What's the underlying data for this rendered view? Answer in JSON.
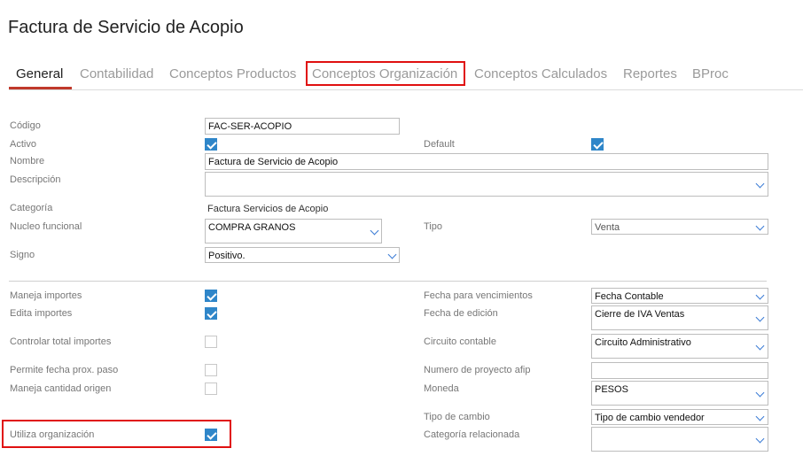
{
  "title": "Factura de Servicio de Acopio",
  "tabs": [
    "General",
    "Contabilidad",
    "Conceptos Productos",
    "Conceptos Organización",
    "Conceptos Calculados",
    "Reportes",
    "BProc"
  ],
  "accent_color": "#c0392b",
  "highlight_color": "#e01010",
  "checkbox_color": "#2f86c9",
  "form": {
    "codigo_label": "Código",
    "codigo_value": "FAC-SER-ACOPIO",
    "activo_label": "Activo",
    "activo_checked": true,
    "default_label": "Default",
    "default_checked": true,
    "nombre_label": "Nombre",
    "nombre_value": "Factura de Servicio de Acopio",
    "descripcion_label": "Descripción",
    "descripcion_value": "",
    "categoria_label": "Categoría",
    "categoria_value": "Factura Servicios de Acopio",
    "nucleo_label": "Nucleo funcional",
    "nucleo_value": "COMPRA GRANOS",
    "tipo_label": "Tipo",
    "tipo_value": "Venta",
    "signo_label": "Signo",
    "signo_value": "Positivo.",
    "maneja_importes_label": "Maneja importes",
    "maneja_importes_checked": true,
    "edita_importes_label": "Edita importes",
    "edita_importes_checked": true,
    "controlar_total_label": "Controlar total importes",
    "controlar_total_checked": false,
    "permite_fecha_label": "Permite fecha prox. paso",
    "permite_fecha_checked": false,
    "maneja_cantidad_label": "Maneja cantidad origen",
    "maneja_cantidad_checked": false,
    "utiliza_org_label": "Utiliza organización",
    "utiliza_org_checked": true,
    "fecha_venc_label": "Fecha para vencimientos",
    "fecha_venc_value": "Fecha Contable",
    "fecha_edicion_label": "Fecha de edición",
    "fecha_edicion_value": "Cierre de IVA Ventas",
    "circuito_label": "Circuito contable",
    "circuito_value": "Circuito Administrativo",
    "numero_proyecto_label": "Numero de proyecto afip",
    "numero_proyecto_value": "",
    "moneda_label": "Moneda",
    "moneda_value": "PESOS",
    "tipo_cambio_label": "Tipo de cambio",
    "tipo_cambio_value": "Tipo de cambio vendedor",
    "categoria_rel_label": "Categoría relacionada",
    "categoria_rel_value": ""
  }
}
